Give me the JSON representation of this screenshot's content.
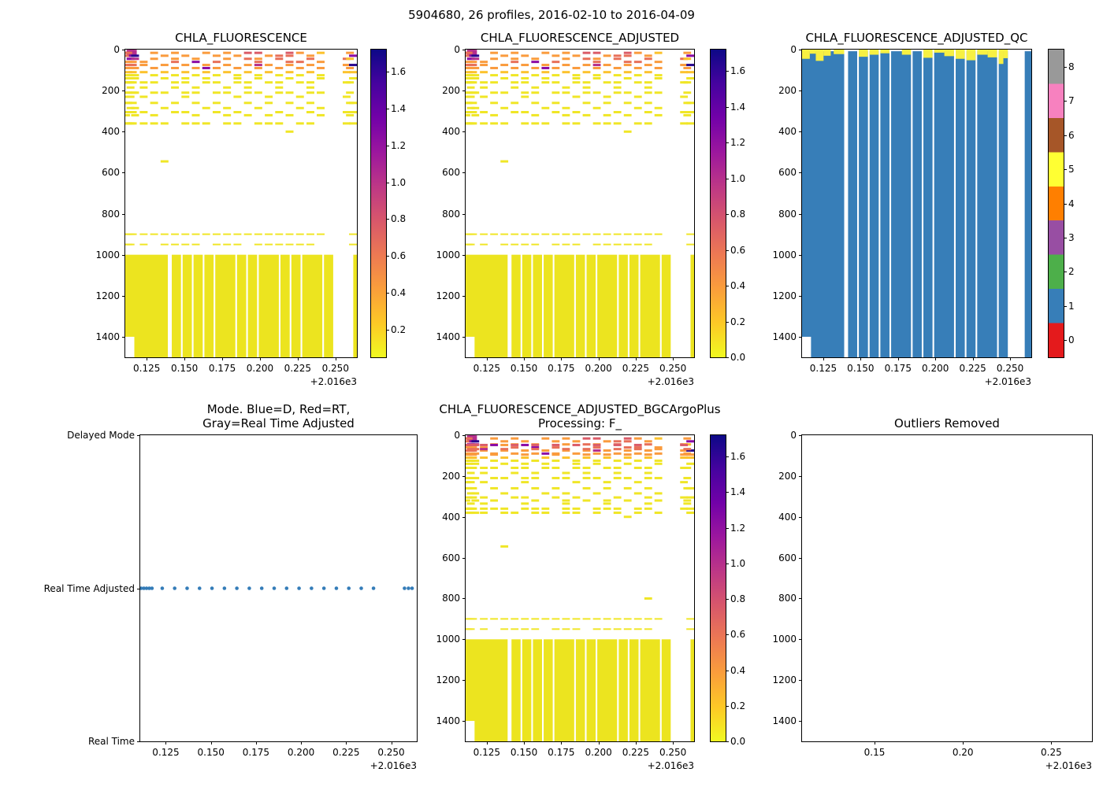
{
  "figure_title": "5904680, 26 profiles, 2016-02-10 to 2016-04-09",
  "colors": {
    "plasma_r_bottom_to_top": [
      "#f0f921",
      "#fdc926",
      "#fa9e3b",
      "#ed7953",
      "#d8576b",
      "#bd3786",
      "#9c179e",
      "#7201a8",
      "#46039f",
      "#0d0887"
    ],
    "qc_palette_0_to_8": [
      "#e41a1c",
      "#377eb8",
      "#4daf4a",
      "#984ea3",
      "#ff7f00",
      "#ffff33",
      "#a65628",
      "#f781bf",
      "#999999"
    ],
    "deep_yellow": "#ece41f",
    "qc_blue": "#377eb8",
    "qc_cap_yellow": "#f7f042",
    "mode_dot": "#347cb8",
    "white": "#ffffff",
    "dash": {
      "Y": "#f0e626",
      "LO": "#fcc22d",
      "O": "#fa9b3d",
      "SA": "#e87059",
      "RE": "#db5c68",
      "MA": "#b42e8d",
      "PU": "#8b0aa5",
      "NV": "#2a0a90"
    }
  },
  "profiles_x": [
    0.1113,
    0.1128,
    0.1143,
    0.1158,
    0.1173,
    0.123,
    0.1299,
    0.1368,
    0.1437,
    0.1506,
    0.1575,
    0.1644,
    0.1713,
    0.1782,
    0.1851,
    0.192,
    0.1989,
    0.2058,
    0.2127,
    0.2196,
    0.2265,
    0.2334,
    0.2402,
    0.2574,
    0.2596,
    0.2616
  ],
  "deep_blocks": [
    [
      0.1108,
      0.139
    ],
    [
      0.1416,
      0.1477
    ],
    [
      0.1488,
      0.1549
    ],
    [
      0.156,
      0.1621
    ],
    [
      0.1632,
      0.1693
    ],
    [
      0.1704,
      0.1837
    ],
    [
      0.1848,
      0.1909
    ],
    [
      0.192,
      0.1981
    ],
    [
      0.1992,
      0.2125
    ],
    [
      0.2136,
      0.2197
    ],
    [
      0.2208,
      0.2269
    ],
    [
      0.228,
      0.2413
    ],
    [
      0.2424,
      0.2485
    ],
    [
      0.2618,
      0.2642
    ]
  ],
  "qc_blocks": [
    [
      0.1108,
      0.139
    ],
    [
      0.1416,
      0.1477
    ],
    [
      0.1488,
      0.1549
    ],
    [
      0.156,
      0.1621
    ],
    [
      0.1632,
      0.1693
    ],
    [
      0.1704,
      0.1837
    ],
    [
      0.1848,
      0.1909
    ],
    [
      0.192,
      0.1981
    ],
    [
      0.1992,
      0.2125
    ],
    [
      0.2136,
      0.2197
    ],
    [
      0.2208,
      0.2269
    ],
    [
      0.228,
      0.2413
    ],
    [
      0.2424,
      0.2485
    ],
    [
      0.2598,
      0.2642
    ]
  ],
  "qc_caps": [
    [
      0.1108,
      0.116,
      45
    ],
    [
      0.116,
      0.12,
      20
    ],
    [
      0.12,
      0.1252,
      55
    ],
    [
      0.1252,
      0.13,
      30
    ],
    [
      0.132,
      0.139,
      22
    ],
    [
      0.1488,
      0.1549,
      35
    ],
    [
      0.156,
      0.1621,
      25
    ],
    [
      0.1632,
      0.1693,
      18
    ],
    [
      0.1776,
      0.1837,
      25
    ],
    [
      0.192,
      0.1981,
      40
    ],
    [
      0.1992,
      0.206,
      15
    ],
    [
      0.206,
      0.2125,
      32
    ],
    [
      0.2136,
      0.2197,
      45
    ],
    [
      0.2208,
      0.2269,
      52
    ],
    [
      0.228,
      0.235,
      25
    ],
    [
      0.235,
      0.2413,
      38
    ],
    [
      0.2424,
      0.2455,
      70
    ],
    [
      0.2455,
      0.2485,
      42
    ]
  ],
  "notch": [
    0.1108,
    0.1168,
    1400,
    1500
  ],
  "rows_main": [
    [
      14,
      "MA",
      [
        2,
        3
      ],
      7
    ],
    [
      16,
      "SA",
      [
        0,
        1
      ]
    ],
    [
      16,
      "O",
      [
        6,
        8,
        11,
        13,
        20,
        24
      ]
    ],
    [
      16,
      "RE",
      [
        15,
        16,
        19
      ]
    ],
    [
      16,
      "LO",
      [
        22
      ]
    ],
    [
      30,
      "SA",
      [
        1,
        2
      ]
    ],
    [
      30,
      "PU",
      [
        3
      ]
    ],
    [
      30,
      "NV",
      [
        4
      ]
    ],
    [
      30,
      "O",
      [
        7,
        9,
        12,
        14,
        17,
        21
      ]
    ],
    [
      30,
      "SA",
      [
        18,
        19
      ]
    ],
    [
      30,
      "PU",
      [
        25
      ]
    ],
    [
      45,
      "PU",
      [
        2
      ]
    ],
    [
      45,
      "MA",
      [
        4
      ]
    ],
    [
      45,
      "O",
      [
        6,
        8,
        10,
        13,
        16
      ]
    ],
    [
      45,
      "SA",
      [
        15,
        18,
        21,
        23
      ]
    ],
    [
      45,
      "LO",
      [
        24
      ]
    ],
    [
      60,
      "O",
      [
        1,
        3,
        5
      ]
    ],
    [
      60,
      "SA",
      [
        8,
        12,
        16,
        19,
        20
      ]
    ],
    [
      60,
      "PU",
      [
        10
      ]
    ],
    [
      60,
      "O",
      [
        22
      ]
    ],
    [
      75,
      "SA",
      [
        0,
        1,
        2,
        3
      ]
    ],
    [
      75,
      "O",
      [
        5,
        7,
        9,
        11,
        13,
        15,
        17,
        19,
        21,
        23
      ]
    ],
    [
      75,
      "MA",
      [
        16
      ]
    ],
    [
      75,
      "NV",
      [
        25
      ]
    ],
    [
      90,
      "O",
      [
        0,
        2,
        4,
        6,
        8,
        10,
        12,
        14,
        16,
        18,
        20,
        22,
        24
      ]
    ],
    [
      90,
      "PU",
      [
        11
      ]
    ],
    [
      110,
      "LO",
      [
        1,
        3,
        5,
        7,
        9,
        11,
        13,
        15,
        17,
        19,
        21,
        23,
        25
      ]
    ],
    [
      125,
      "Y",
      [
        0,
        2,
        4,
        6,
        8,
        10,
        12,
        14,
        16,
        18,
        20,
        22
      ]
    ],
    [
      140,
      "Y",
      [
        1,
        4,
        7,
        9,
        11,
        14,
        16,
        19,
        22,
        25
      ]
    ],
    [
      160,
      "Y",
      [
        0,
        1,
        2,
        3,
        5,
        6,
        8,
        9,
        11,
        12,
        14,
        15,
        17,
        18,
        20,
        21,
        23,
        24
      ]
    ],
    [
      185,
      "Y",
      [
        2,
        5,
        8,
        10,
        13,
        15,
        18,
        21
      ]
    ],
    [
      210,
      "Y",
      [
        0,
        1,
        3,
        4,
        6,
        7,
        9,
        10,
        12,
        13,
        15,
        16,
        18,
        19,
        21,
        22,
        24
      ]
    ],
    [
      230,
      "Y",
      [
        0,
        2,
        5,
        9,
        14,
        17,
        20,
        23
      ]
    ],
    [
      260,
      "Y",
      [
        0,
        1,
        3,
        6,
        8,
        10,
        12,
        15,
        17,
        19,
        21,
        24,
        25
      ]
    ],
    [
      285,
      "Y",
      [
        2,
        4,
        7,
        11,
        13,
        16,
        20,
        22
      ]
    ],
    [
      305,
      "Y",
      [
        1,
        3,
        5,
        8,
        9,
        12,
        14,
        18,
        21,
        23,
        25
      ]
    ],
    [
      320,
      "Y",
      [
        0,
        4,
        6,
        10,
        13,
        15,
        17,
        19,
        22,
        24
      ]
    ],
    [
      360,
      "Y",
      [
        0,
        1,
        2,
        3,
        5,
        6,
        7,
        9,
        10,
        11,
        13,
        14,
        16,
        17,
        18,
        20,
        21,
        23,
        25
      ]
    ],
    [
      400,
      "Y",
      [
        19
      ]
    ],
    [
      545,
      "Y",
      [
        7
      ]
    ],
    [
      900,
      "Y",
      [
        0,
        1,
        2,
        3,
        5,
        6,
        7,
        8,
        9,
        10,
        11,
        12,
        13,
        14,
        15,
        16,
        17,
        18,
        19,
        20,
        21,
        22,
        25
      ],
      2
    ],
    [
      950,
      "Y",
      [
        0,
        1,
        2,
        5,
        7,
        8,
        9,
        10,
        12,
        13,
        14,
        16,
        17,
        18,
        19,
        20,
        21,
        25
      ],
      2
    ]
  ],
  "rows_bgc_extra": [
    [
      48,
      "RE",
      [
        0,
        1,
        2,
        3,
        4,
        5,
        8,
        10,
        12,
        14,
        16,
        18,
        20,
        23
      ]
    ],
    [
      48,
      "PU",
      [
        6,
        9
      ]
    ],
    [
      48,
      "O",
      [
        7
      ]
    ],
    [
      68,
      "SA",
      [
        2,
        4,
        7,
        10,
        13,
        15,
        18,
        20,
        24
      ]
    ],
    [
      68,
      "MA",
      [
        5
      ]
    ],
    [
      68,
      "O",
      [
        22
      ]
    ],
    [
      95,
      "O",
      [
        1,
        3,
        6,
        9,
        12,
        15,
        17,
        19,
        21,
        23,
        25
      ]
    ],
    [
      335,
      "Y",
      [
        2,
        5,
        9,
        13,
        17,
        21,
        24
      ]
    ],
    [
      380,
      "Y",
      [
        0,
        1,
        2,
        4,
        5,
        7,
        8,
        10,
        11,
        13,
        14,
        16,
        18,
        20,
        22,
        25
      ]
    ],
    [
      800,
      "Y",
      [
        21
      ]
    ]
  ],
  "ticks_time": {
    "labels": [
      "0.125",
      "0.150",
      "0.175",
      "0.200",
      "0.225",
      "0.250"
    ],
    "values": [
      0.125,
      0.15,
      0.175,
      0.2,
      0.225,
      0.25
    ]
  },
  "ticks_time_sparse": {
    "labels": [
      "0.15",
      "0.20",
      "0.25"
    ],
    "values": [
      0.15,
      0.2,
      0.25
    ]
  },
  "ticks_depth": {
    "labels": [
      "0",
      "200",
      "400",
      "600",
      "800",
      "1000",
      "1200",
      "1400"
    ],
    "values": [
      0,
      200,
      400,
      600,
      800,
      1000,
      1200,
      1400
    ]
  },
  "ticks_mode": {
    "labels": [
      "Delayed Mode",
      "Real Time Adjusted",
      "Real Time"
    ],
    "values": [
      2,
      1,
      0
    ]
  },
  "chart_data": [
    {
      "type": "heatmap",
      "title": "CHLA_FLUORESCENCE",
      "xlim": [
        0.1108,
        0.2642
      ],
      "ylim": [
        0,
        1500
      ],
      "xticks": "ticks_time",
      "yticks": "ticks_depth",
      "x_offset_label": "+2.016e3",
      "deep": true,
      "deep_depth": [
        1000,
        1500
      ],
      "rows": [
        "rows_main"
      ],
      "use_notch": true,
      "colorbar": {
        "kind": "gradient",
        "vmin": 0.05,
        "vmax": 1.72,
        "tick_labels": [
          "0.2",
          "0.4",
          "0.6",
          "0.8",
          "1.0",
          "1.2",
          "1.4",
          "1.6"
        ],
        "tick_values": [
          0.2,
          0.4,
          0.6,
          0.8,
          1.0,
          1.2,
          1.4,
          1.6
        ]
      }
    },
    {
      "type": "heatmap",
      "title": "CHLA_FLUORESCENCE_ADJUSTED",
      "xlim": [
        0.1108,
        0.2642
      ],
      "ylim": [
        0,
        1500
      ],
      "xticks": "ticks_time",
      "yticks": "ticks_depth",
      "x_offset_label": "+2.016e3",
      "deep": true,
      "deep_depth": [
        1000,
        1500
      ],
      "rows": [
        "rows_main"
      ],
      "use_notch": true,
      "colorbar": {
        "kind": "gradient",
        "vmin": 0.0,
        "vmax": 1.72,
        "tick_labels": [
          "0.0",
          "0.2",
          "0.4",
          "0.6",
          "0.8",
          "1.0",
          "1.2",
          "1.4",
          "1.6"
        ],
        "tick_values": [
          0.0,
          0.2,
          0.4,
          0.6,
          0.8,
          1.0,
          1.2,
          1.4,
          1.6
        ]
      }
    },
    {
      "type": "qc",
      "title": "CHLA_FLUORESCENCE_ADJUSTED_QC",
      "xlim": [
        0.1108,
        0.2642
      ],
      "ylim": [
        0,
        1500
      ],
      "xticks": "ticks_time",
      "yticks": "ticks_depth",
      "x_offset_label": "+2.016e3",
      "use_notch": true,
      "colorbar": {
        "kind": "categorical",
        "tick_labels": [
          "0",
          "1",
          "2",
          "3",
          "4",
          "5",
          "6",
          "7",
          "8"
        ],
        "tick_values": [
          0,
          1,
          2,
          3,
          4,
          5,
          6,
          7,
          8
        ]
      }
    },
    {
      "type": "scatter",
      "title": "Mode. Blue=D, Red=RT,\nGray=Real Time Adjusted",
      "xlim": [
        0.1108,
        0.2642
      ],
      "ylim": [
        2,
        0
      ],
      "xticks": "ticks_time",
      "yticks": "ticks_mode",
      "x_offset_label": "+2.016e3",
      "dot_y": 1,
      "dot_level_label": "Real Time Adjusted"
    },
    {
      "type": "heatmap",
      "title": "CHLA_FLUORESCENCE_ADJUSTED_BGCArgoPlus\nProcessing: F_",
      "xlim": [
        0.1108,
        0.2642
      ],
      "ylim": [
        0,
        1500
      ],
      "xticks": "ticks_time",
      "yticks": "ticks_depth",
      "x_offset_label": "+2.016e3",
      "deep": true,
      "deep_depth": [
        1000,
        1500
      ],
      "rows": [
        "rows_main",
        "rows_bgc_extra"
      ],
      "use_notch": true,
      "colorbar": {
        "kind": "gradient",
        "vmin": 0.0,
        "vmax": 1.72,
        "tick_labels": [
          "0.0",
          "0.2",
          "0.4",
          "0.6",
          "0.8",
          "1.0",
          "1.2",
          "1.4",
          "1.6"
        ],
        "tick_values": [
          0.0,
          0.2,
          0.4,
          0.6,
          0.8,
          1.0,
          1.2,
          1.4,
          1.6
        ]
      }
    },
    {
      "type": "empty",
      "title": "Outliers Removed",
      "xlim": [
        0.109,
        0.273
      ],
      "ylim": [
        0,
        1500
      ],
      "xticks": "ticks_time_sparse",
      "yticks": "ticks_depth",
      "x_offset_label": "+2.016e3"
    }
  ]
}
